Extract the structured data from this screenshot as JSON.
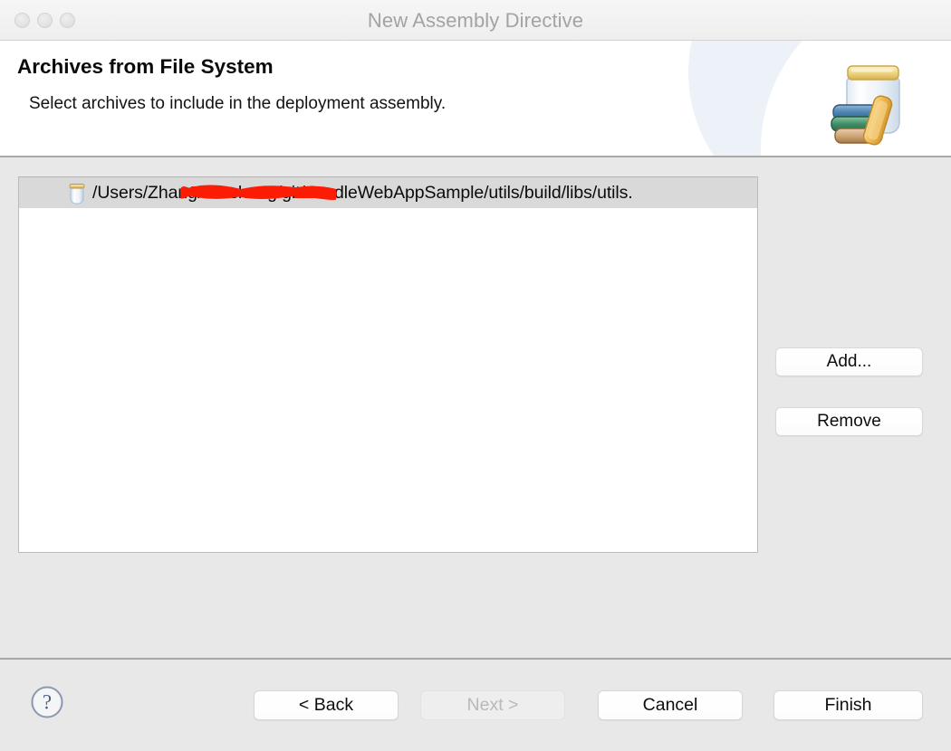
{
  "window": {
    "title": "New Assembly Directive",
    "traffic_lights": [
      "close",
      "minimize",
      "maximize"
    ]
  },
  "header": {
    "title": "Archives from File System",
    "subtitle": "Select archives to include in the deployment assembly.",
    "banner_icon": "jar-of-archives-icon"
  },
  "archives": {
    "items": [
      {
        "icon": "jar-icon",
        "path": "/Users/Zhangxiansheng/git/GradleWebAppSample/utils/build/libs/utils.",
        "redacted": true,
        "selected": true
      }
    ]
  },
  "side_buttons": {
    "add_label": "Add...",
    "remove_label": "Remove"
  },
  "footer": {
    "help_icon": "help-question-icon",
    "back_label": "< Back",
    "next_label": "Next >",
    "next_disabled": true,
    "cancel_label": "Cancel",
    "finish_label": "Finish"
  },
  "colors": {
    "window_bg": "#e8e8e8",
    "titlebar_bg": "#f2f2f2",
    "title_text": "#a3a3a3",
    "header_bg": "#ffffff",
    "divider": "#a9a9a9",
    "list_bg": "#ffffff",
    "selected_row_bg": "#d9d9d9",
    "redaction": "#fc1c03",
    "help_icon": "#5a6b84"
  }
}
